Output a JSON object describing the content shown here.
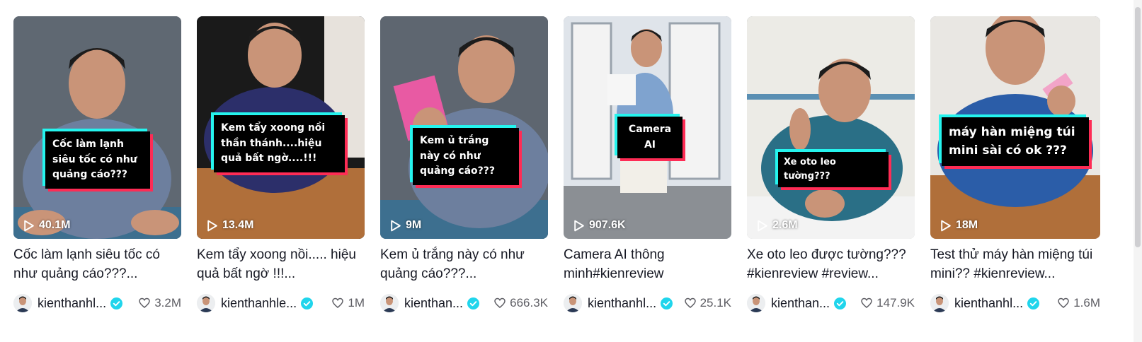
{
  "videos": [
    {
      "overlay_text": "Cốc làm lạnh siêu tốc có như quảng cáo???",
      "plays": "40.1M",
      "title": "Cốc làm lạnh siêu tốc có như quảng cáo???...",
      "author": "kienthanhl...",
      "likes": "3.2M"
    },
    {
      "overlay_text": "Kem tẩy xoong nồi thần thánh....hiệu quả bất ngờ....!!!",
      "plays": "13.4M",
      "title": "Kem tẩy xoong nồi..... hiệu quả bất ngờ !!!...",
      "author": "kienthanhle...",
      "likes": "1M"
    },
    {
      "overlay_text": "Kem ủ trắng này có như quảng cáo???",
      "plays": "9M",
      "title": "Kem ủ trắng này có như quảng cáo???...",
      "author": "kienthan...",
      "likes": "666.3K"
    },
    {
      "overlay_text": "Camera AI",
      "plays": "907.6K",
      "title": "Camera AI thông minh#kienreview",
      "author": "kienthanhl...",
      "likes": "25.1K"
    },
    {
      "overlay_text": "Xe oto leo tường???",
      "plays": "2.6M",
      "title": "Xe oto leo được tường??? #kienreview #review...",
      "author": "kienthan...",
      "likes": "147.9K"
    },
    {
      "overlay_text": "máy hàn miệng túi mini sài có ok ???",
      "plays": "18M",
      "title": "Test thử máy hàn miệng túi mini?? #kienreview...",
      "author": "kienthanhl...",
      "likes": "1.6M"
    }
  ],
  "icons": {
    "play": "play-icon",
    "verified": "verified-badge-icon",
    "heart": "heart-icon"
  },
  "colors": {
    "verified": "#20d5ec",
    "overlay_cyan": "#25f4ee",
    "overlay_red": "#fe2c55"
  }
}
